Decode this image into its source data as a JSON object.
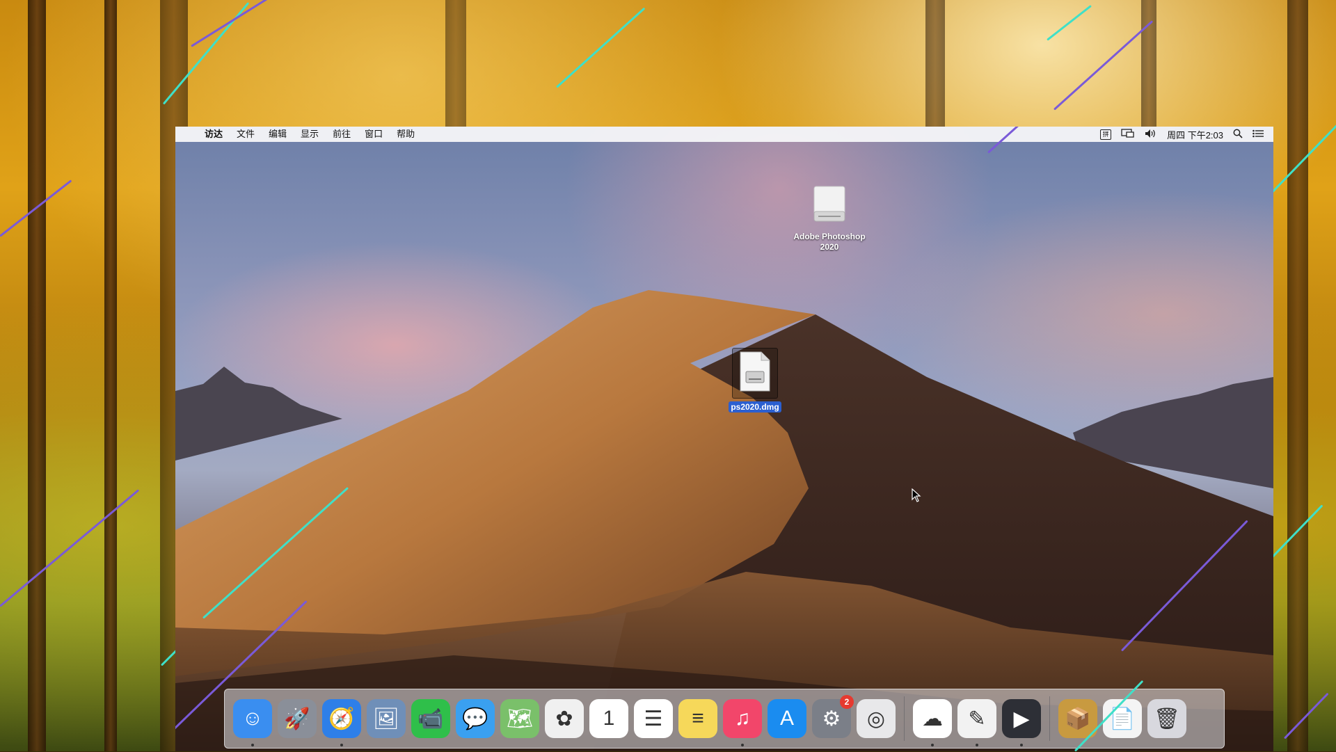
{
  "menubar": {
    "apple": "",
    "items": [
      "访达",
      "文件",
      "编辑",
      "显示",
      "前往",
      "窗口",
      "帮助"
    ],
    "input_method": "拼",
    "clock": "周四 下午2:03"
  },
  "desktop": {
    "volume_label_line1": "Adobe Photoshop",
    "volume_label_line2": "2020",
    "file_label": "ps2020.dmg"
  },
  "dock": {
    "apps": [
      {
        "name": "finder-icon",
        "glyph": "☺",
        "color": "#3a8ef0",
        "running": true
      },
      {
        "name": "launchpad-icon",
        "glyph": "🚀",
        "color": "#8a8f99",
        "running": false
      },
      {
        "name": "safari-icon",
        "glyph": "🧭",
        "color": "#2e7fe8",
        "running": true
      },
      {
        "name": "preview-icon",
        "glyph": "🖼",
        "color": "#6f8fb8",
        "running": false
      },
      {
        "name": "facetime-icon",
        "glyph": "📹",
        "color": "#2fbf4a",
        "running": false
      },
      {
        "name": "messages-icon",
        "glyph": "💬",
        "color": "#3aa0f0",
        "running": false
      },
      {
        "name": "maps-icon",
        "glyph": "🗺",
        "color": "#7ac06a",
        "running": false
      },
      {
        "name": "photos-icon",
        "glyph": "✿",
        "color": "#f0f0f0",
        "running": false
      },
      {
        "name": "calendar-icon",
        "glyph": "1",
        "color": "#ffffff",
        "running": false
      },
      {
        "name": "reminders-icon",
        "glyph": "☰",
        "color": "#ffffff",
        "running": false
      },
      {
        "name": "notes-icon",
        "glyph": "≡",
        "color": "#f6d85a",
        "running": false
      },
      {
        "name": "music-icon",
        "glyph": "♫",
        "color": "#f2466a",
        "running": true
      },
      {
        "name": "app-store-icon",
        "glyph": "A",
        "color": "#1a8cf0",
        "running": false
      },
      {
        "name": "system-preferences-icon",
        "glyph": "⚙",
        "color": "#7b7f88",
        "running": false,
        "badge": "2"
      },
      {
        "name": "screenshot-icon",
        "glyph": "◎",
        "color": "#e8e8ea",
        "running": false
      }
    ],
    "apps2": [
      {
        "name": "baidu-netdisk-icon",
        "glyph": "☁",
        "color": "#ffffff",
        "running": true
      },
      {
        "name": "pages-icon",
        "glyph": "✎",
        "color": "#f2f2f2",
        "running": true
      },
      {
        "name": "zoom-icon",
        "glyph": "▶",
        "color": "#2d2f36",
        "running": true
      }
    ],
    "apps3": [
      {
        "name": "installer-icon",
        "glyph": "📦",
        "color": "#c89a40",
        "running": false
      },
      {
        "name": "document-icon",
        "glyph": "📄",
        "color": "#f4f4f4",
        "running": false
      },
      {
        "name": "trash-icon",
        "glyph": "🗑",
        "color": "#d8d8de",
        "running": false
      }
    ],
    "badge_count": "2"
  }
}
